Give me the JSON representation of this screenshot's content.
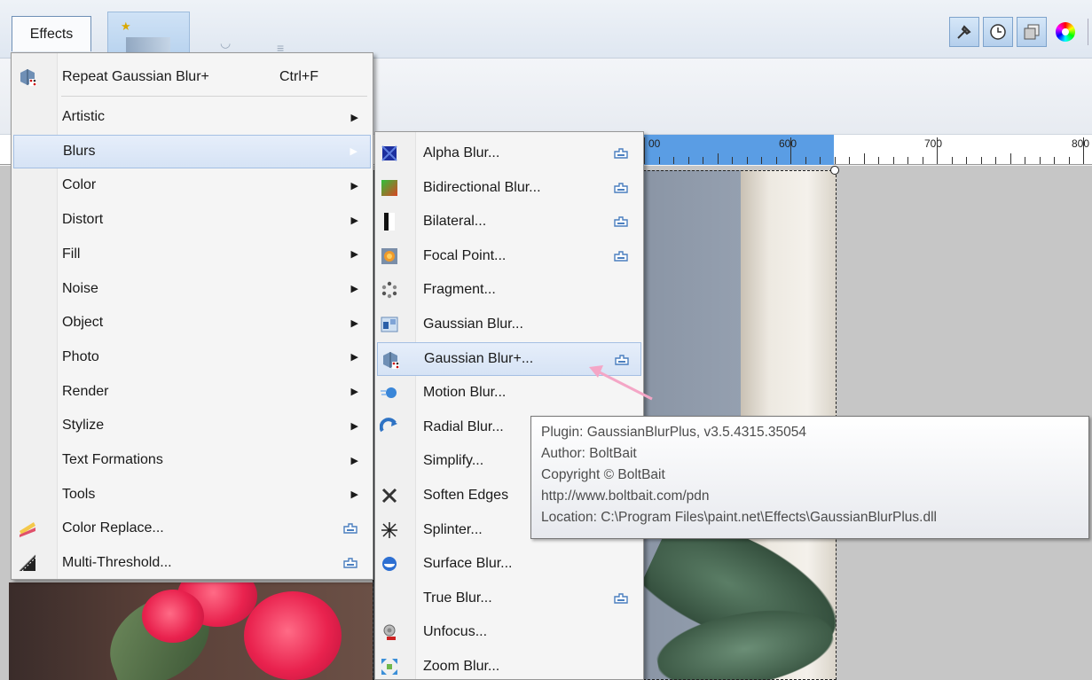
{
  "menubar": {
    "effects_label": "Effects"
  },
  "ruler": {
    "labels": [
      "00",
      "600",
      "700",
      "800"
    ]
  },
  "effects_menu": {
    "repeat": {
      "label": "Repeat Gaussian Blur+",
      "shortcut": "Ctrl+F",
      "icon": "gaussian-blur-plus-icon"
    },
    "items": [
      {
        "label": "Artistic",
        "submenu": true
      },
      {
        "label": "Blurs",
        "submenu": true,
        "highlighted": true
      },
      {
        "label": "Color",
        "submenu": true
      },
      {
        "label": "Distort",
        "submenu": true
      },
      {
        "label": "Fill",
        "submenu": true
      },
      {
        "label": "Noise",
        "submenu": true
      },
      {
        "label": "Object",
        "submenu": true
      },
      {
        "label": "Photo",
        "submenu": true
      },
      {
        "label": "Render",
        "submenu": true
      },
      {
        "label": "Stylize",
        "submenu": true
      },
      {
        "label": "Text Formations",
        "submenu": true
      },
      {
        "label": "Tools",
        "submenu": true
      },
      {
        "label": "Color Replace...",
        "plugin": true,
        "icon": "color-replace-icon"
      },
      {
        "label": "Multi-Threshold...",
        "plugin": true,
        "icon": "multi-threshold-icon"
      }
    ]
  },
  "blurs_menu": {
    "items": [
      {
        "label": "Alpha Blur...",
        "plugin": true,
        "icon": "alpha-blur-icon"
      },
      {
        "label": "Bidirectional Blur...",
        "plugin": true,
        "icon": "bidirectional-blur-icon"
      },
      {
        "label": "Bilateral...",
        "plugin": true,
        "icon": "bilateral-icon"
      },
      {
        "label": "Focal Point...",
        "plugin": true,
        "icon": "focal-point-icon"
      },
      {
        "label": "Fragment...",
        "plugin": false,
        "icon": "fragment-icon"
      },
      {
        "label": "Gaussian Blur...",
        "plugin": false,
        "icon": "gaussian-blur-icon"
      },
      {
        "label": "Gaussian Blur+...",
        "plugin": true,
        "highlighted": true,
        "icon": "gaussian-blur-plus-icon"
      },
      {
        "label": "Motion Blur...",
        "plugin": false,
        "icon": "motion-blur-icon"
      },
      {
        "label": "Radial Blur...",
        "plugin": false,
        "icon": "radial-blur-icon"
      },
      {
        "label": "Simplify...",
        "plugin": false,
        "icon": ""
      },
      {
        "label": "Soften Edges",
        "plugin": false,
        "icon": "soften-edges-icon"
      },
      {
        "label": "Splinter...",
        "plugin": false,
        "icon": "splinter-icon"
      },
      {
        "label": "Surface Blur...",
        "plugin": false,
        "icon": "surface-blur-icon"
      },
      {
        "label": "True Blur...",
        "plugin": true,
        "icon": ""
      },
      {
        "label": "Unfocus...",
        "plugin": false,
        "icon": "unfocus-icon"
      },
      {
        "label": "Zoom Blur...",
        "plugin": false,
        "icon": "zoom-blur-icon"
      }
    ]
  },
  "tooltip": {
    "lines": [
      "Plugin: GaussianBlurPlus, v3.5.4315.35054",
      "Author: BoltBait",
      "Copyright © BoltBait",
      "http://www.boltbait.com/pdn",
      "Location: C:\\Program Files\\paint.net\\Effects\\GaussianBlurPlus.dll"
    ]
  },
  "colors": {
    "menu_bg": "#f5f5f5",
    "highlight_bg": "#d6e3f5",
    "highlight_border": "#a4bfe3",
    "ruler_selection": "#5a9de4",
    "pointer_arrow": "#f4a6c6"
  }
}
